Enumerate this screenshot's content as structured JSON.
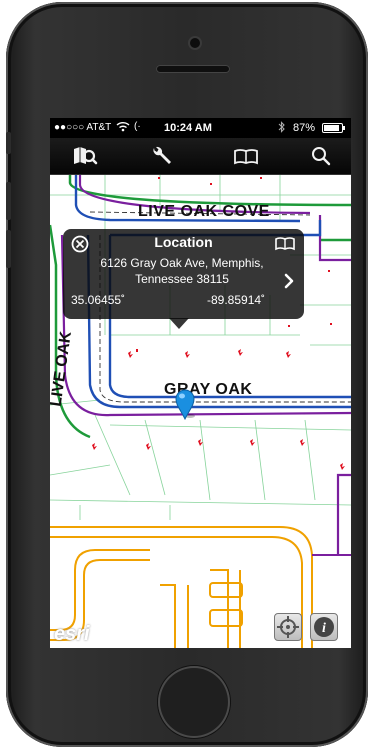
{
  "status_bar": {
    "carrier": "●●○○○ AT&T",
    "time": "10:24 AM",
    "battery": "87%"
  },
  "toolbar": {
    "icons": [
      "map-search-icon",
      "wrench-icon",
      "book-icon",
      "search-icon"
    ]
  },
  "map": {
    "street_labels": [
      "LIVE OAK COVE",
      "LIVE OAK",
      "GRAY OAK"
    ],
    "watermark": "esri"
  },
  "callout": {
    "title": "Location",
    "address_line1": "6126 Gray Oak Ave, Memphis,",
    "address_line2": "Tennessee 38115",
    "latitude": "35.06455˚",
    "longitude": "-89.85914˚"
  },
  "colors": {
    "road_blue": "#1f4fb5",
    "road_purple": "#7a1f9e",
    "road_green": "#1e9a3a",
    "parcel_green": "#86d39a",
    "school_orange": "#f0a100",
    "marker_red": "#e01020",
    "pin_blue": "#1a8fe0"
  }
}
